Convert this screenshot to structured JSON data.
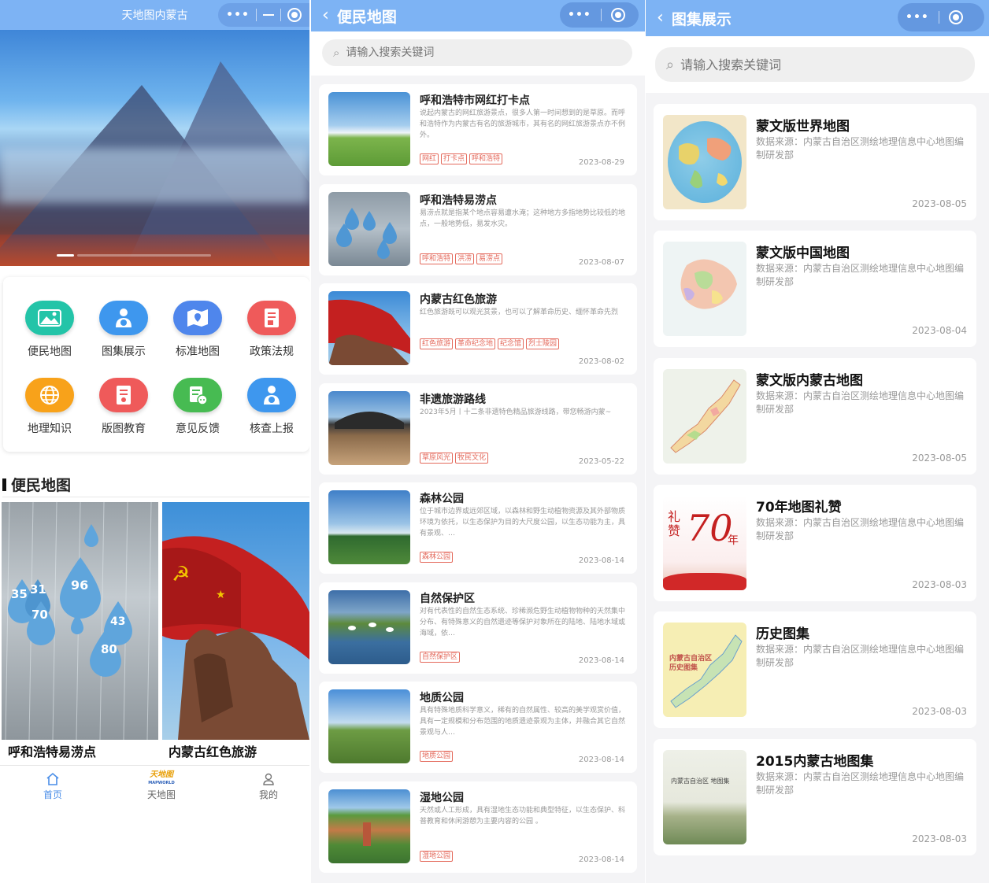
{
  "home": {
    "title": "天地图内蒙古",
    "grid": [
      {
        "label": "便民地图",
        "icon": "image-icon",
        "color": "#23c4a8"
      },
      {
        "label": "图集展示",
        "icon": "user-globe-icon",
        "color": "#3e97ee"
      },
      {
        "label": "标准地图",
        "icon": "map-icon",
        "color": "#4f86ec"
      },
      {
        "label": "政策法规",
        "icon": "document-icon",
        "color": "#ef5a5a"
      },
      {
        "label": "地理知识",
        "icon": "globe-icon",
        "color": "#f8a21a"
      },
      {
        "label": "版图教育",
        "icon": "document-icon",
        "color": "#ef5a5a"
      },
      {
        "label": "意见反馈",
        "icon": "chat-icon",
        "color": "#47bb52"
      },
      {
        "label": "核查上报",
        "icon": "user-globe-icon",
        "color": "#3e97ee"
      }
    ],
    "section_title": "便民地图",
    "featured": [
      {
        "label": "呼和浩特易涝点"
      },
      {
        "label": "内蒙古红色旅游"
      }
    ],
    "map_numbers": [
      "35",
      "31",
      "96",
      "70",
      "43",
      "80"
    ],
    "tabs": [
      {
        "label": "首页",
        "icon": "home-icon"
      },
      {
        "label": "天地图",
        "icon": "tianditu-logo"
      },
      {
        "label": "我的",
        "icon": "user-icon"
      }
    ],
    "logo_text": "天地图",
    "logo_sub": "MAPWORLD"
  },
  "convenience": {
    "title": "便民地图",
    "search_placeholder": "请输入搜索关键词",
    "items": [
      {
        "title": "呼和浩特市网红打卡点",
        "desc": "说起内蒙古的网红旅游景点，很多人第一时间想到的是草原。而呼和浩特作为内蒙古有名的旅游城市，其有名的网红旅游景点亦不例外。",
        "tags": [
          "网红",
          "打卡点",
          "呼和浩特"
        ],
        "date": "2023-08-29"
      },
      {
        "title": "呼和浩特易涝点",
        "desc": "易涝点就是指某个地点容易遭水淹；这种地方多指地势比较低的地点，一般地势低，易发水灾。",
        "tags": [
          "呼和浩特",
          "洪涝",
          "易涝点"
        ],
        "date": "2023-08-07"
      },
      {
        "title": "内蒙古红色旅游",
        "desc": "红色旅游既可以观光赏景，也可以了解革命历史、缅怀革命先烈",
        "tags": [
          "红色旅游",
          "革命纪念地",
          "纪念馆",
          "烈士陵园"
        ],
        "date": "2023-08-02"
      },
      {
        "title": "非遗旅游路线",
        "desc": "2023年5月丨十二条非遗特色精品旅游线路，带您畅游内蒙~",
        "tags": [
          "草原风光",
          "牧民文化"
        ],
        "date": "2023-05-22"
      },
      {
        "title": "森林公园",
        "desc": "位于城市边界或远郊区域，以森林和野生动植物资源及其外部物质环境为依托，以生态保护为目的大尺度公园，以生态功能为主，具有景观、…",
        "tags": [
          "森林公园"
        ],
        "date": "2023-08-14"
      },
      {
        "title": "自然保护区",
        "desc": "对有代表性的自然生态系统、珍稀濒危野生动植物物种的天然集中分布、有特殊意义的自然遗迹等保护对象所在的陆地、陆地水域或海域，依…",
        "tags": [
          "自然保护区"
        ],
        "date": "2023-08-14"
      },
      {
        "title": "地质公园",
        "desc": "具有特殊地质科学意义，稀有的自然属性、较高的美学观赏价值，具有一定规模和分布范围的地质遗迹景观为主体，并融合其它自然景观与人…",
        "tags": [
          "地质公园"
        ],
        "date": "2023-08-14"
      },
      {
        "title": "湿地公园",
        "desc": "天然或人工形成，具有湿地生态功能和典型特征，以生态保护、科普教育和休闲游憩为主要内容的公园 。",
        "tags": [
          "湿地公园"
        ],
        "date": "2023-08-14"
      }
    ]
  },
  "atlas": {
    "title": "图集展示",
    "search_placeholder": "请输入搜索关键词",
    "items": [
      {
        "title": "蒙文版世界地图",
        "source": "数据来源：内蒙古自治区测绘地理信息中心地图编制研发部",
        "date": "2023-08-05"
      },
      {
        "title": "蒙文版中国地图",
        "source": "数据来源：内蒙古自治区测绘地理信息中心地图编制研发部",
        "date": "2023-08-04"
      },
      {
        "title": "蒙文版内蒙古地图",
        "source": "数据来源：内蒙古自治区测绘地理信息中心地图编制研发部",
        "date": "2023-08-05"
      },
      {
        "title": "70年地图礼赞",
        "source": "数据来源：内蒙古自治区测绘地理信息中心地图编制研发部",
        "date": "2023-08-03"
      },
      {
        "title": "历史图集",
        "source": "数据来源：内蒙古自治区测绘地理信息中心地图编制研发部",
        "date": "2023-08-03"
      },
      {
        "title": "2015内蒙古地图集",
        "source": "数据来源：内蒙古自治区测绘地理信息中心地图编制研发部",
        "date": "2023-08-03"
      }
    ],
    "thumb_texts": {
      "zan": "礼赞",
      "seventy": "70",
      "nian": "年",
      "history": "内蒙古自治区 历史图集",
      "atlas2015": "内蒙古自治区 地图集"
    }
  }
}
